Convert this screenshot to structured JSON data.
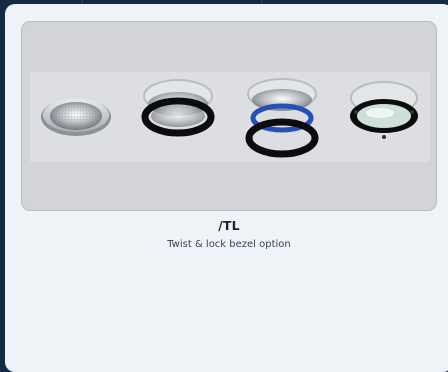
{
  "product": {
    "title": "/TL",
    "description": "Twist & lock bezel option"
  },
  "colors": {
    "page_background": "#142a44",
    "card_background": "#eef3f7",
    "image_background": "#d3d4d7",
    "bezel_black": "#0c0c0e",
    "ring_blue": "#2550b8"
  }
}
